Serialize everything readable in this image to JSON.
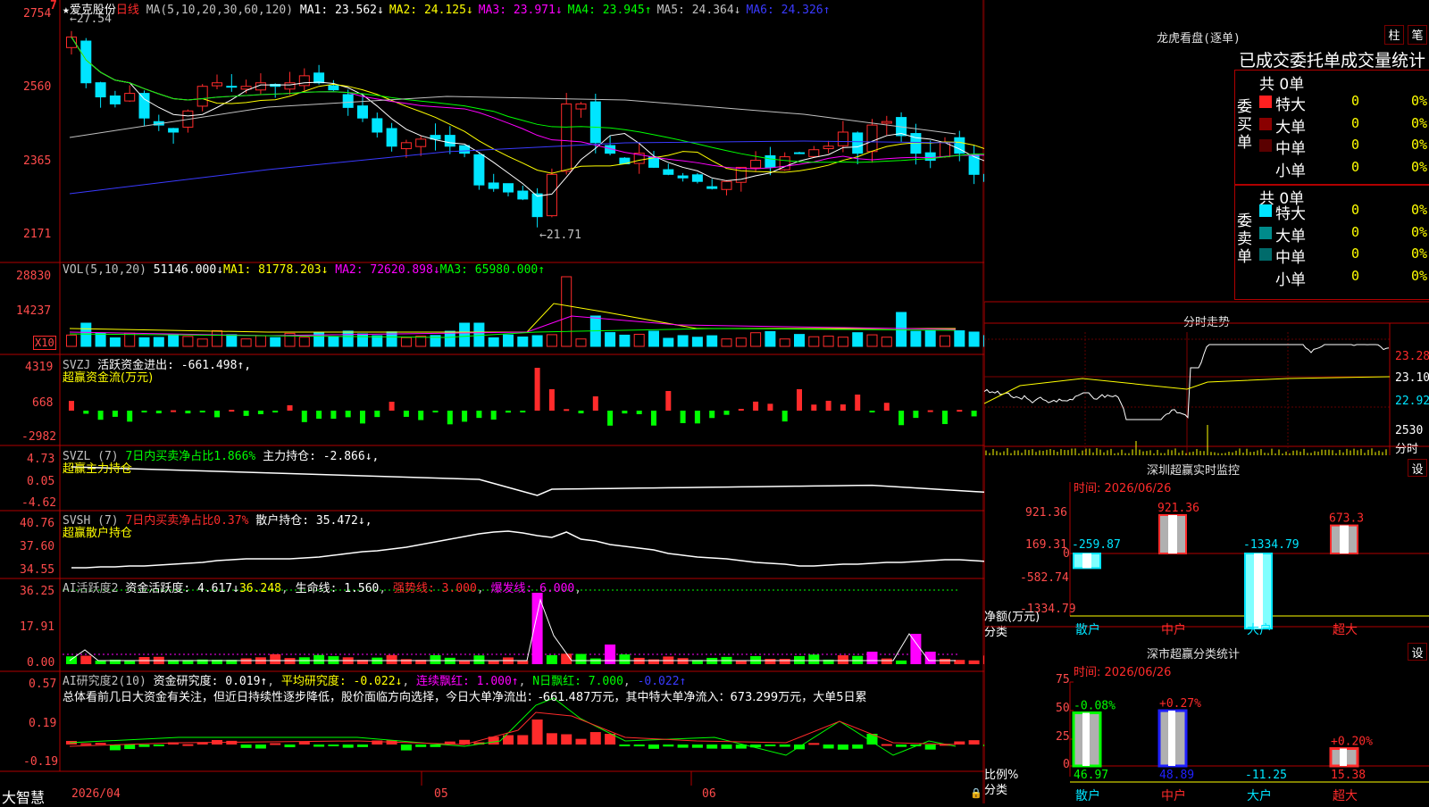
{
  "colors": {
    "up": "#ff2b2b",
    "down": "#00e5ff",
    "white": "#ffffff",
    "yellow": "#ffff00",
    "magenta": "#ff00ff",
    "green": "#00ff00",
    "blue": "#3a3aff",
    "frame": "#b00000",
    "grid": "#400000"
  },
  "kline": {
    "star": "★",
    "name": "爱克股份",
    "period": "日线",
    "ma_label": "MA(5,10,20,30,60,120)",
    "ma": [
      {
        "label": "MA1: 23.562↓",
        "color": "#ffffff"
      },
      {
        "label": "MA2: 24.125↓",
        "color": "#ffff00"
      },
      {
        "label": "MA3: 23.971↓",
        "color": "#ff00ff"
      },
      {
        "label": "MA4: 23.945↑",
        "color": "#00ff00"
      },
      {
        "label": "MA5: 24.364↓",
        "color": "#c0c0c0"
      },
      {
        "label": "MA6: 24.326↑",
        "color": "#3a3aff"
      }
    ],
    "high_note": "←27.54",
    "low_note": "←21.71",
    "y_ticks": [
      "2754",
      "2560",
      "2365",
      "2171"
    ],
    "corner_mark": "7"
  },
  "vol": {
    "label": "VOL(5,10,20)",
    "value": "51146.000↓",
    "ma1": "MA1: 81778.203↓",
    "ma2": "MA2: 72620.898↓",
    "ma3": "MA3: 65980.000↑",
    "y_ticks": [
      "28830",
      "14237"
    ],
    "unit": "X10"
  },
  "svzj": {
    "label": "SVZJ",
    "item": "活跃资金进出: -661.498↑,",
    "subtitle": "超赢资金流(万元)",
    "y_ticks": [
      "4319",
      "668",
      "-2982"
    ]
  },
  "svzl": {
    "label": "SVZL (7)",
    "item1": "7日内买卖净占比1.866%",
    "item2": "主力持仓: -2.866↓,",
    "subtitle": "超赢主力持仓",
    "y_ticks": [
      "4.73",
      "0.05",
      "-4.62"
    ]
  },
  "svsh": {
    "label": "SVSH (7)",
    "item1": "7日内买卖净占比0.37%",
    "item2": "散户持仓: 35.472↓,",
    "subtitle": "超赢散户持仓",
    "y_ticks": [
      "40.76",
      "37.60",
      "34.55"
    ]
  },
  "ai1": {
    "label": "AI活跃度2",
    "item1": "资金活跃度: 4.617↓",
    "item2": "36.248",
    "item3": "生命线: 1.560",
    "item4": "强势线: 3.000",
    "item5": "爆发线: 6.000",
    "y_ticks": [
      "36.25",
      "17.91",
      "0.00"
    ]
  },
  "ai2": {
    "label": "AI研究度2(10)",
    "item1": "资金研究度: 0.019↑",
    "item2": "平均研究度: -0.022↓",
    "item3": "连续飘红: 1.000↑",
    "item4": "N日飘红: 7.000",
    "item5": "-0.022↑",
    "summary": "总体看前几日大资金有关注，但近日持续性逐步降低，股价面临方向选择，今日大单净流出：-661.487万元，其中特大单净流入：673.299万元，大单5日累",
    "y_ticks": [
      "0.57",
      "0.19",
      "-0.19"
    ]
  },
  "xaxis": {
    "brand": "大智慧",
    "d1": "2026/04",
    "d2": "05",
    "d3": "06"
  },
  "dragon": {
    "title": "龙虎看盘(逐单)",
    "btn1": "柱",
    "btn2": "笔",
    "table_title": "已成交委托单成交量统计",
    "buy_label": "委买单",
    "sell_label": "委卖单",
    "buy_total": "共 0单",
    "sell_total": "共 0单",
    "buy_rows": [
      {
        "name": "特大",
        "count": "0",
        "pct": "0%",
        "color": "#ff2020"
      },
      {
        "name": "大单",
        "count": "0",
        "pct": "0%",
        "color": "#8a0000"
      },
      {
        "name": "中单",
        "count": "0",
        "pct": "0%",
        "color": "#5a0000"
      },
      {
        "name": "小单",
        "count": "0",
        "pct": "0%",
        "color": ""
      }
    ],
    "sell_rows": [
      {
        "name": "特大",
        "count": "0",
        "pct": "0%",
        "color": "#00e5ff"
      },
      {
        "name": "大单",
        "count": "0",
        "pct": "0%",
        "color": "#008b8b"
      },
      {
        "name": "中单",
        "count": "0",
        "pct": "0%",
        "color": "#006b6b"
      },
      {
        "name": "小单",
        "count": "0",
        "pct": "0%",
        "color": ""
      }
    ]
  },
  "intraday": {
    "title": "分时走势",
    "prices": [
      "23.28",
      "23.10",
      "22.92"
    ],
    "vol": "2530",
    "vol_label": "分时"
  },
  "sz_monitor": {
    "title": "深圳超赢实时监控",
    "settings": "设",
    "time_label": "时间: 2026/06/26",
    "y_ticks": [
      "921.36",
      "169.31",
      "0",
      "-582.74",
      "-1334.79"
    ],
    "ylabel": "净额(万元)",
    "xlabel": "分类",
    "bars": [
      {
        "cat": "散户",
        "value": -259.87,
        "label": "-259.87"
      },
      {
        "cat": "中户",
        "value": 921.36,
        "label": "921.36"
      },
      {
        "cat": "大户",
        "value": -1334.79,
        "label": "-1334.79"
      },
      {
        "cat": "超大",
        "value": 673.3,
        "label": "673.3"
      }
    ]
  },
  "sz_class": {
    "title": "深市超赢分类统计",
    "settings": "设",
    "time_label": "时间: 2026/06/26",
    "y_ticks": [
      "75",
      "50",
      "25",
      "0"
    ],
    "ylabel": "比例%",
    "xlabel": "分类",
    "bars": [
      {
        "cat": "散户",
        "value": 46.97,
        "value_label": "46.97",
        "delta": "-0.08%"
      },
      {
        "cat": "中户",
        "value": 48.89,
        "value_label": "48.89",
        "delta": "+0.27%"
      },
      {
        "cat": "大户",
        "value": -11.25,
        "value_label": "-11.25",
        "delta": ""
      },
      {
        "cat": "超大",
        "value": 15.38,
        "value_label": "15.38",
        "delta": "+0.20%"
      }
    ]
  }
}
